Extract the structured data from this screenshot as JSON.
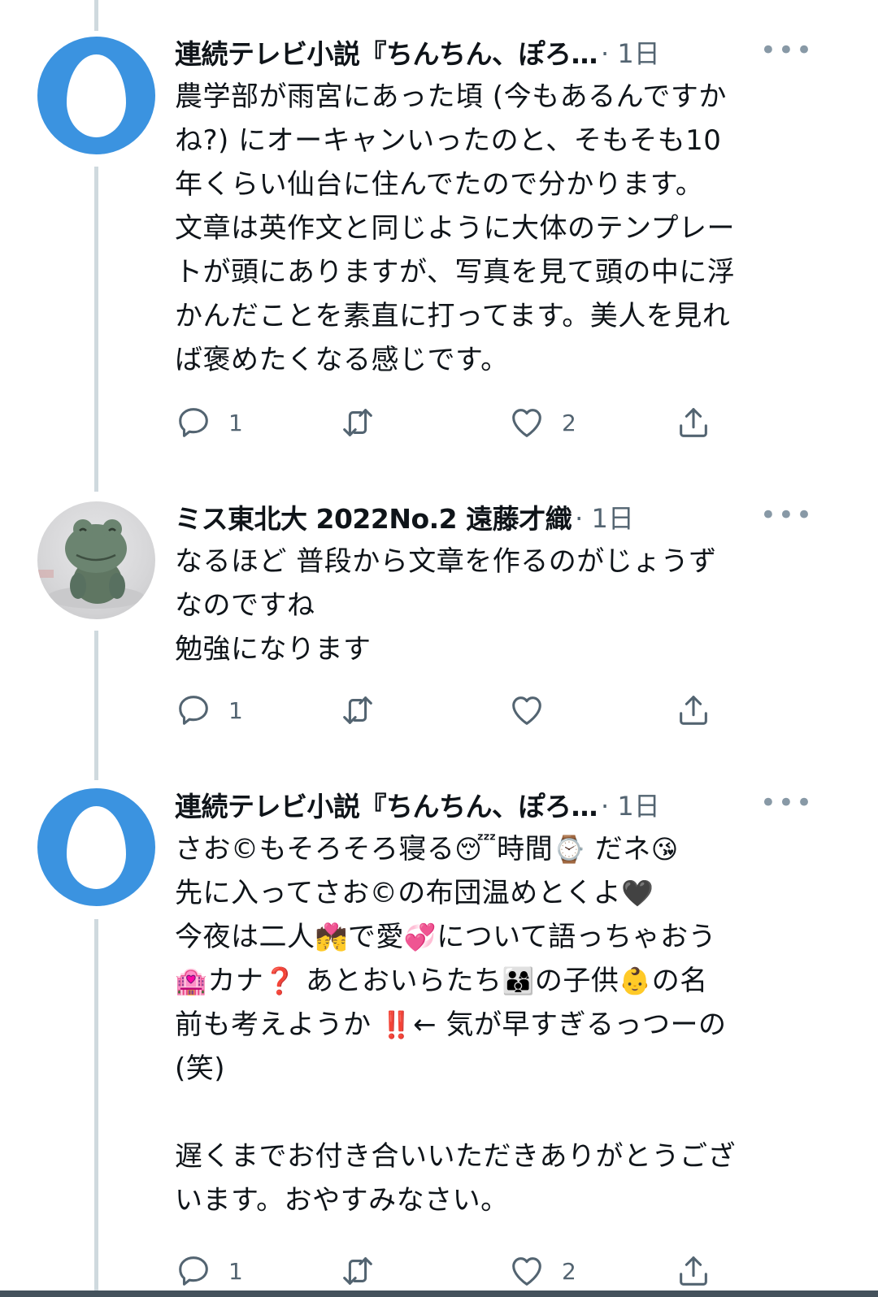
{
  "tweets": [
    {
      "author": "連続テレビ小説『ちんちん、ぽろ…",
      "time": "· 1日",
      "more_label": "•••",
      "text": "農学部が雨宮にあった頃 (今もあるんですか\nね?) にオーキャンいったのと、そもそも10\n年くらい仙台に住んでたので分かります。\n文章は英作文と同じように大体のテンプレー\nトが頭にありますが、写真を見て頭の中に浮\nかんだことを素直に打ってます。美人を見れ\nば褒めたくなる感じです。",
      "reply_count": "1",
      "like_count": "2"
    },
    {
      "author": "ミス東北大 2022No.2 遠藤才織",
      "time": "· 1日",
      "more_label": "•••",
      "text": "なるほど 普段から文章を作るのがじょうず\nなのですね\n勉強になります",
      "reply_count": "1",
      "like_count": ""
    },
    {
      "author": "連続テレビ小説『ちんちん、ぽろ…",
      "time": "· 1日",
      "more_label": "•••",
      "segments": [
        {
          "text": "さお©もそろそろ寝る"
        },
        {
          "emoji": "😴",
          "icon": "sleeping-face-icon"
        },
        {
          "text": "時間"
        },
        {
          "emoji": "⌚",
          "icon": "watch-icon"
        },
        {
          "text": " だネ"
        },
        {
          "emoji": "😘",
          "icon": "kissing-face-icon"
        },
        {
          "text": "\n先に入ってさお©の布団温めとくよ"
        },
        {
          "emoji": "🖤",
          "icon": "black-heart-icon"
        },
        {
          "text": "\n今夜は二人"
        },
        {
          "emoji": "💏",
          "icon": "couple-kiss-icon"
        },
        {
          "text": "で愛"
        },
        {
          "emoji": "💞",
          "icon": "revolving-hearts-icon"
        },
        {
          "text": "について語っちゃおう\n"
        },
        {
          "emoji": "🏩",
          "icon": "love-hotel-icon"
        },
        {
          "text": "カナ"
        },
        {
          "emoji": "❓",
          "icon": "question-mark-icon"
        },
        {
          "text": " あとおいらたち"
        },
        {
          "emoji": "👨‍👩‍👦",
          "icon": "family-icon"
        },
        {
          "text": "の子供"
        },
        {
          "emoji": "👶",
          "icon": "baby-icon"
        },
        {
          "text": "の名\n前も考えようか "
        },
        {
          "emoji": "‼️",
          "icon": "double-exclamation-icon"
        },
        {
          "text": "← 気が早すぎるっつーの\n(笑)\n\n遅くまでお付き合いいただきありがとうござ\nいます。おやすみなさい。"
        }
      ],
      "reply_count": "1",
      "like_count": "2"
    }
  ]
}
